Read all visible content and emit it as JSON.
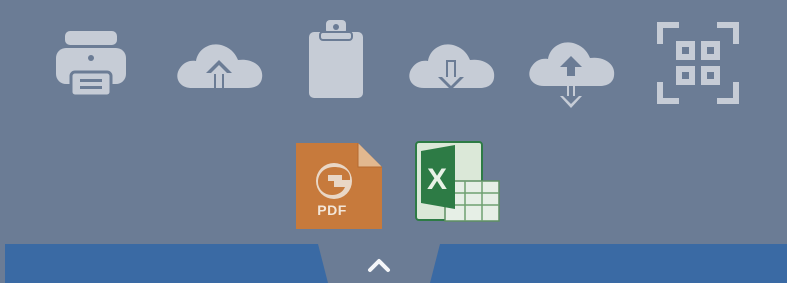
{
  "toolbar": {
    "icons": [
      {
        "name": "printer-icon"
      },
      {
        "name": "cloud-upload-icon"
      },
      {
        "name": "clipboard-icon"
      },
      {
        "name": "cloud-download-icon"
      },
      {
        "name": "cloud-sync-icon"
      },
      {
        "name": "scan-frame-icon"
      }
    ]
  },
  "files": {
    "pdf_label": "PDF",
    "excel_letter": "X"
  },
  "colors": {
    "panel_bg": "#6b7c95",
    "icon_fill": "#c6ccd6",
    "bottom_bar": "#3a6aa4",
    "pdf_orange": "#c77a3c",
    "excel_green": "#2d7b45"
  }
}
